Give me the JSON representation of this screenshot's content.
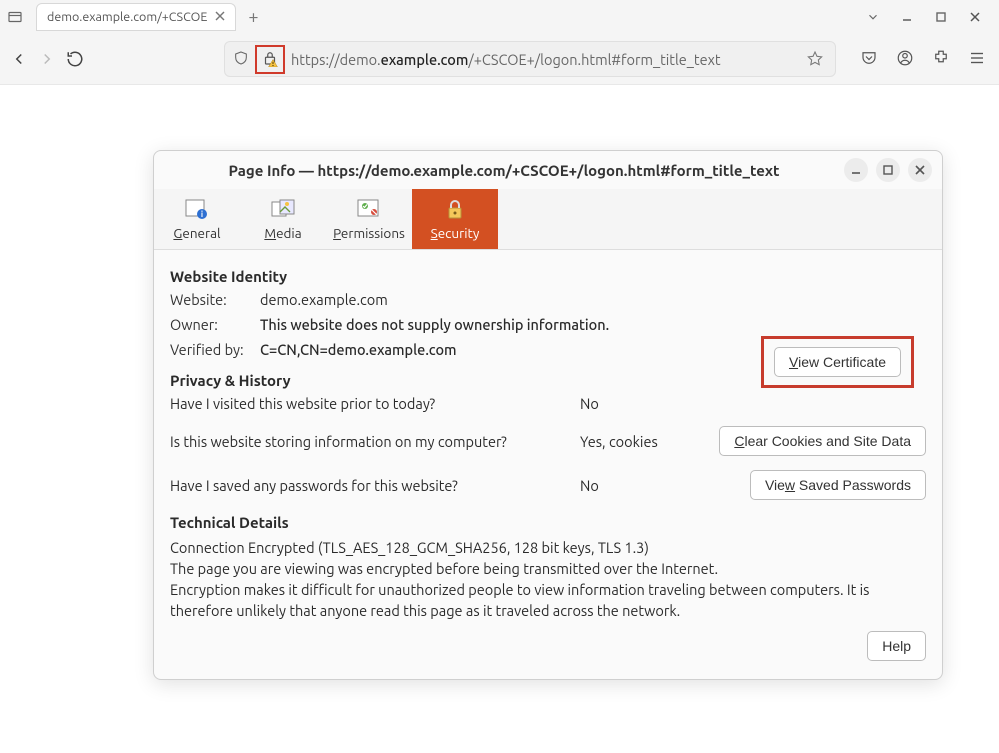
{
  "browser": {
    "tab_title": "demo.example.com/+CSCOE",
    "url_proto": "https://",
    "url_host_pre": "demo.",
    "url_host_bold": "example.com",
    "url_path": "/+CSCOE+/logon.html#form_title_text"
  },
  "dialog": {
    "title": "Page Info — https://demo.example.com/+CSCOE+/logon.html#form_title_text",
    "tabs": {
      "general": "General",
      "media": "Media",
      "permissions": "Permissions",
      "security": "Security"
    },
    "identity": {
      "heading": "Website Identity",
      "website_label": "Website:",
      "website_value": "demo.example.com",
      "owner_label": "Owner:",
      "owner_value": "This website does not supply ownership information.",
      "verified_label": "Verified by:",
      "verified_value": "C=CN,CN=demo.example.com",
      "view_cert": "View Certificate"
    },
    "privacy": {
      "heading": "Privacy & History",
      "visited_q": "Have I visited this website prior to today?",
      "visited_a": "No",
      "storing_q": "Is this website storing information on my computer?",
      "storing_a": "Yes, cookies",
      "clear_btn": "Clear Cookies and Site Data",
      "passwords_q": "Have I saved any passwords for this website?",
      "passwords_a": "No",
      "view_saved_btn": "View Saved Passwords"
    },
    "technical": {
      "heading": "Technical Details",
      "line1": "Connection Encrypted (TLS_AES_128_GCM_SHA256, 128 bit keys, TLS 1.3)",
      "line2": "The page you are viewing was encrypted before being transmitted over the Internet.",
      "line3": "Encryption makes it difficult for unauthorized people to view information traveling between computers. It is therefore unlikely that anyone read this page as it traveled across the network.",
      "help_btn": "Help"
    }
  }
}
